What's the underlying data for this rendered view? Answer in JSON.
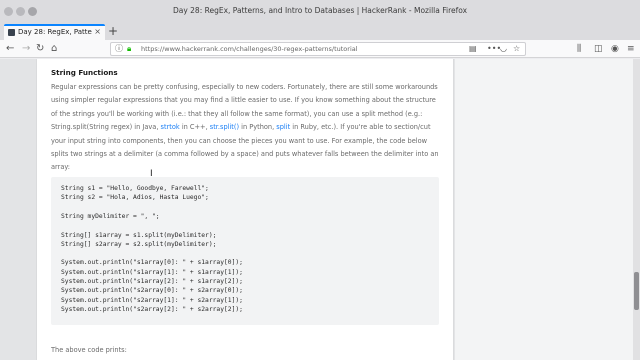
{
  "window": {
    "title": "Day 28: RegEx, Patterns, and Intro to Databases | HackerRank - Mozilla Firefox"
  },
  "tabs": [
    {
      "label": "Day 28: RegEx, Patterns, an",
      "close": "×"
    }
  ],
  "new_tab_label": "+",
  "nav": {
    "back": "←",
    "forward": "→",
    "reload": "↻",
    "home": "⌂"
  },
  "urlbar": {
    "url": "https://www.hackerrank.com/challenges/30-regex-patterns/tutorial",
    "more": "•••"
  },
  "article": {
    "heading": "String Functions",
    "para_segments": [
      {
        "text": "Regular expressions can be pretty confusing, especially to new coders. Fortunately, there are still some workarounds using simpler regular expressions that you may find a little easier to use. If you know something about the structure of the strings you'll be working with (i.e.: that they all follow the same format), you can use a split method (e.g.: String.split(String regex) in Java, ",
        "link": false
      },
      {
        "text": "strtok",
        "link": true
      },
      {
        "text": " in C++, ",
        "link": false
      },
      {
        "text": "str.split()",
        "link": true
      },
      {
        "text": " in Python, ",
        "link": false
      },
      {
        "text": "split",
        "link": true
      },
      {
        "text": " in Ruby, etc.). If you're able to section/cut your input string into components, then you can choose the pieces you want to use. For example, the code below splits two strings at a delimiter (a comma followed by a space) and puts whatever falls between the delimiter into an array:",
        "link": false
      }
    ],
    "code_lines": [
      "String s1 = \"Hello, Goodbye, Farewell\";",
      "String s2 = \"Hola, Adios, Hasta Luego\";",
      "",
      "String myDelimiter = \", \";",
      "",
      "String[] s1array = s1.split(myDelimiter);",
      "String[] s2array = s2.split(myDelimiter);",
      "",
      "System.out.println(\"s1array[0]: \" + s1array[0]);",
      "System.out.println(\"s1array[1]: \" + s1array[1]);",
      "System.out.println(\"s1array[2]: \" + s1array[2]);",
      "System.out.println(\"s2array[0]: \" + s2array[0]);",
      "System.out.println(\"s2array[1]: \" + s2array[1]);",
      "System.out.println(\"s2array[2]: \" + s2array[2]);"
    ],
    "after_code": "The above code prints:"
  },
  "colors": {
    "link": "#1b7ff5",
    "accent": "#0a84ff"
  }
}
